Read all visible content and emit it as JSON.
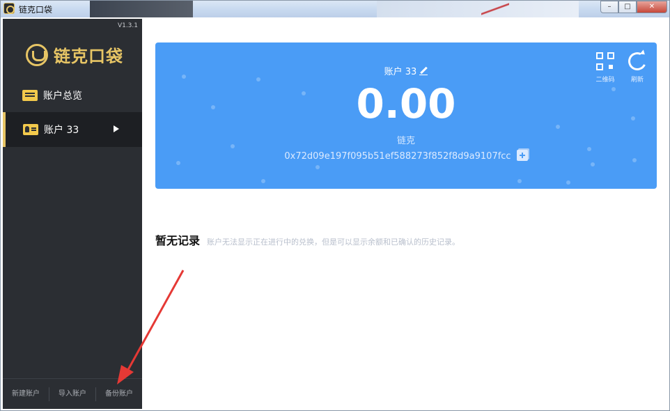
{
  "window": {
    "title": "链克口袋",
    "buttons": {
      "minimize": "–",
      "maximize": "□",
      "close": "✕"
    }
  },
  "sidebar": {
    "version": "V1.3.1",
    "logo_text": "链克口袋",
    "items": [
      {
        "label": "账户总览",
        "icon": "list-icon"
      },
      {
        "label": "账户 33",
        "icon": "id-card-icon",
        "active": true
      }
    ],
    "footer": [
      {
        "label": "新建账户"
      },
      {
        "label": "导入账户"
      },
      {
        "label": "备份账户"
      }
    ]
  },
  "account": {
    "name": "账户 33",
    "balance": "0.00",
    "unit": "链克",
    "address": "0x72d09e197f095b51ef588273f852f8d9a9107fcc",
    "actions": [
      {
        "label": "二维码",
        "icon": "qr-code-icon"
      },
      {
        "label": "刷新",
        "icon": "refresh-icon"
      }
    ]
  },
  "records": {
    "title": "暂无记录",
    "hint": "账户无法显示正在进行中的兑换，但是可以显示余额和已确认的历史记录。"
  },
  "colors": {
    "card": "#4a9cf6",
    "sidebar": "#2b2e33",
    "accent": "#e7c565",
    "annotation_arrow": "#e53935"
  }
}
